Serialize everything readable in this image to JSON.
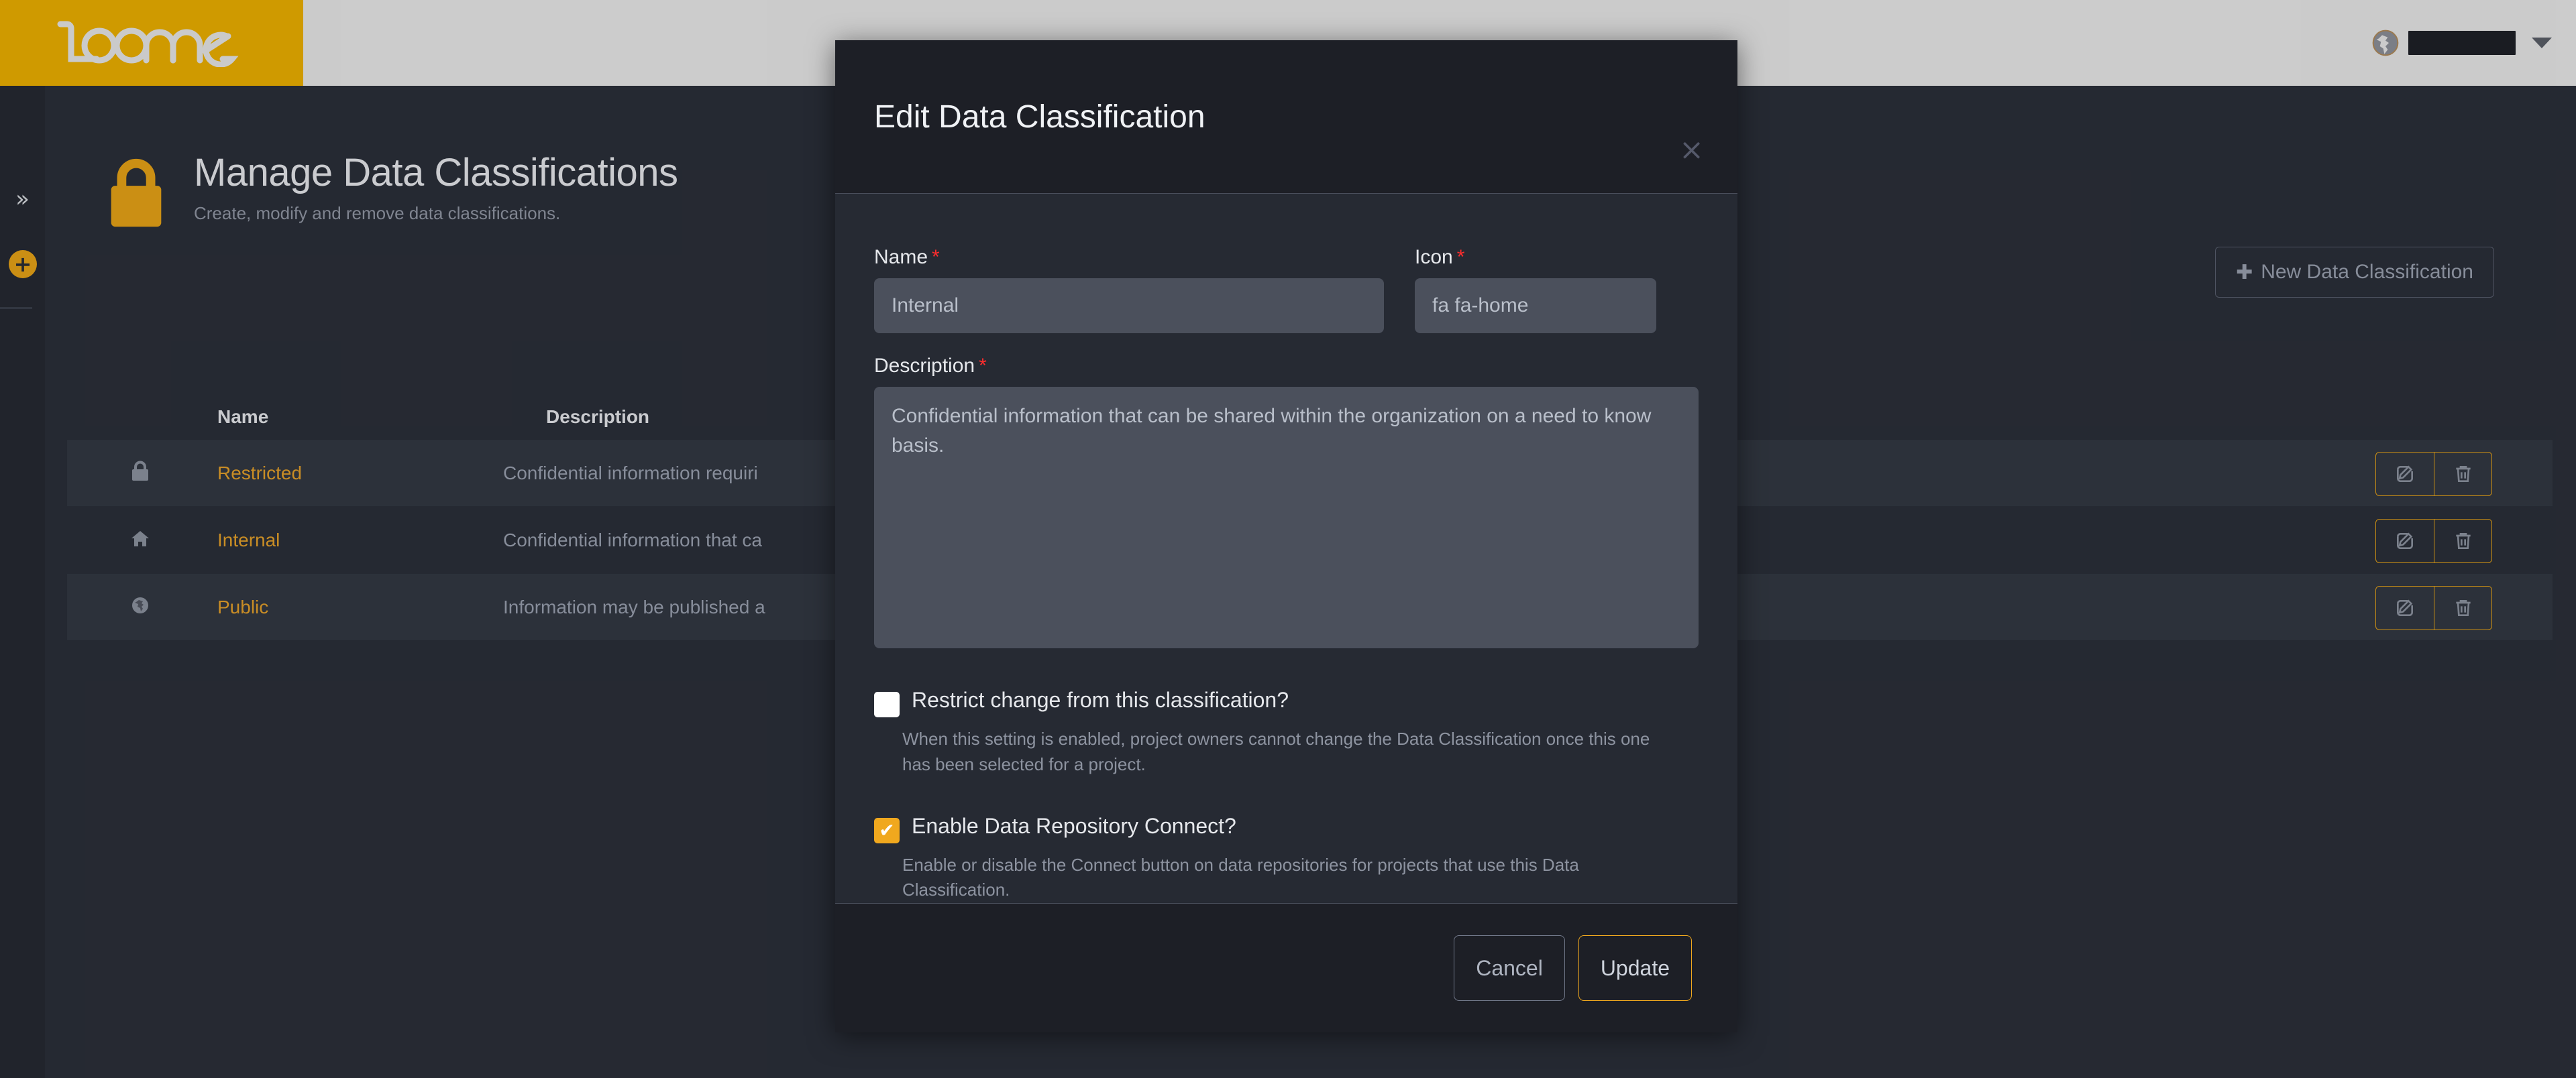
{
  "brand": {
    "logo_text": "loome",
    "logo_bg": "#ecb000",
    "accent": "#e8a317"
  },
  "topbar": {
    "globe_icon": "globe-icon",
    "user_name": "",
    "caret_icon": "chevron-down-icon"
  },
  "sidebar": {
    "expand_icon": "double-chevron-right-icon",
    "expand_label": "»",
    "add_icon": "plus-circle-icon",
    "add_label": "+"
  },
  "page": {
    "icon": "lock-icon",
    "title": "Manage Data Classifications",
    "subtitle": "Create, modify and remove data classifications.",
    "new_button_label": "New Data Classification",
    "new_button_icon": "plus-icon"
  },
  "table": {
    "columns": [
      "Name",
      "Description"
    ],
    "rows": [
      {
        "icon": "lock-icon",
        "name": "Restricted",
        "description": "Confidential information requiri"
      },
      {
        "icon": "home-icon",
        "name": "Internal",
        "description": "Confidential information that ca"
      },
      {
        "icon": "globe-icon",
        "name": "Public",
        "description": "Information may be published a"
      }
    ],
    "actions": {
      "edit_icon": "edit-pencil-icon",
      "delete_icon": "trash-icon"
    }
  },
  "modal": {
    "title": "Edit Data Classification",
    "close_label": "×",
    "fields": {
      "name": {
        "label": "Name",
        "required_mark": "*",
        "value": "",
        "placeholder": "Internal"
      },
      "icon": {
        "label": "Icon",
        "required_mark": "*",
        "value": "",
        "placeholder": "fa fa-home"
      },
      "description": {
        "label": "Description",
        "required_mark": "*",
        "value": "",
        "placeholder": "Confidential information that can be shared within the organization on a need to know basis."
      }
    },
    "checkboxes": [
      {
        "label": "Restrict change from this classification?",
        "checked": false,
        "help": "When this setting is enabled, project owners cannot change the Data Classification once this one has been selected for a project."
      },
      {
        "label": "Enable Data Repository Connect?",
        "checked": true,
        "check_glyph": "✔",
        "help": "Enable or disable the Connect button on data repositories for projects that use this Data Classification."
      }
    ],
    "cancel_label": "Cancel",
    "update_label": "Update"
  }
}
